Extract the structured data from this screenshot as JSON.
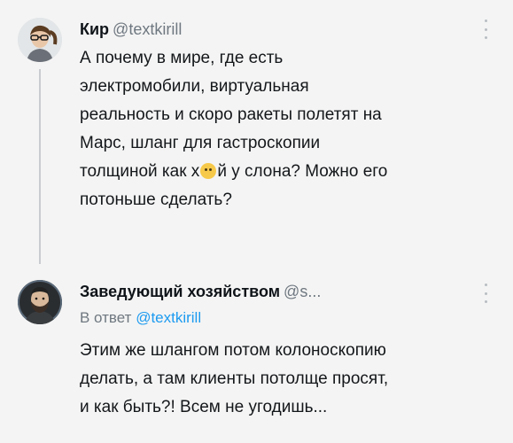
{
  "tweet1": {
    "author_name": "Кир",
    "author_handle": "@textkirill",
    "text_lines": [
      "А почему в мире, где есть",
      "электромобили, виртуальная",
      "реальность и скоро ракеты полетят на",
      "Марс, шланг для гастроскопии",
      "толщиной как х",
      "й у слона? Можно его",
      "потоньше сделать?"
    ],
    "emoji_icon": "thinking-face-icon",
    "avatar_icon": "person-with-glasses-avatar"
  },
  "tweet2": {
    "author_name": "Заведующий хозяйством",
    "author_handle": "@s...",
    "reply_prefix": "В ответ",
    "reply_handle": "@textkirill",
    "text_lines": [
      "Этим же шлангом потом колоноскопию",
      "делать, а там клиенты потолще просят,",
      "и как быть?! Всем не угодишь..."
    ],
    "avatar_icon": "bearded-man-avatar"
  },
  "colors": {
    "background": "#f4f4f4",
    "name": "#0f1419",
    "handle": "#6f7880",
    "link": "#1d9bf0",
    "thread_line": "#c9ccd0"
  }
}
